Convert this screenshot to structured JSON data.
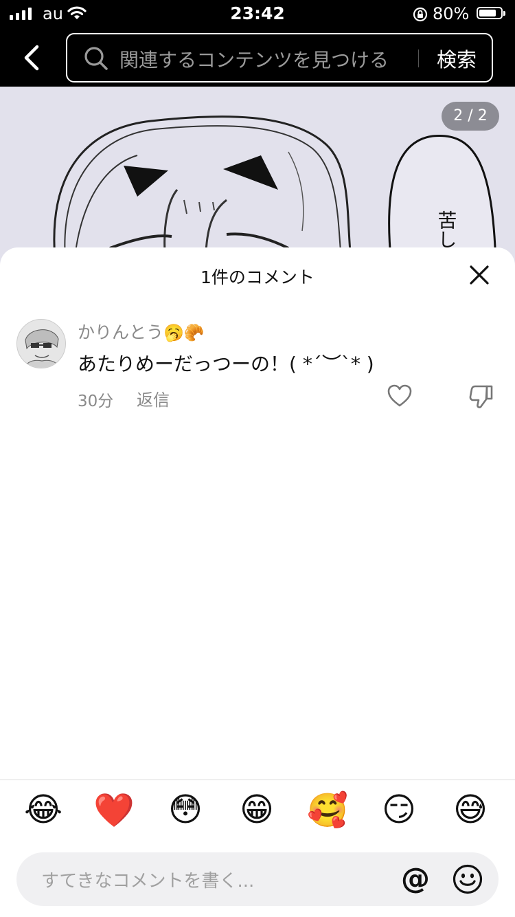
{
  "status_bar": {
    "carrier": "au",
    "time": "23:42",
    "battery_percent": "80%",
    "battery_level": 0.8
  },
  "nav": {
    "search_placeholder": "関連するコンテンツを見つける",
    "search_button": "検索"
  },
  "content": {
    "page_counter": "2 / 2",
    "speech_text": "苦しい"
  },
  "comments_sheet": {
    "title": "1件のコメント",
    "comments": [
      {
        "author": "かりんとう",
        "author_emojis": "🥱🥐",
        "text": "あたりめーだっつーの！( *´︶`* )",
        "time": "30分",
        "reply_label": "返信"
      }
    ]
  },
  "quick_emojis": [
    "😂",
    "❤️",
    "😳",
    "😁",
    "🥰",
    "😏",
    "😅"
  ],
  "composer": {
    "placeholder": "すてきなコメントを書く...",
    "mention_symbol": "@"
  },
  "icons": {
    "back": "chevron-left-icon",
    "search": "search-icon",
    "close": "close-icon",
    "like": "heart-icon",
    "dislike": "thumbs-down-icon",
    "emoji_picker": "smiley-icon"
  }
}
